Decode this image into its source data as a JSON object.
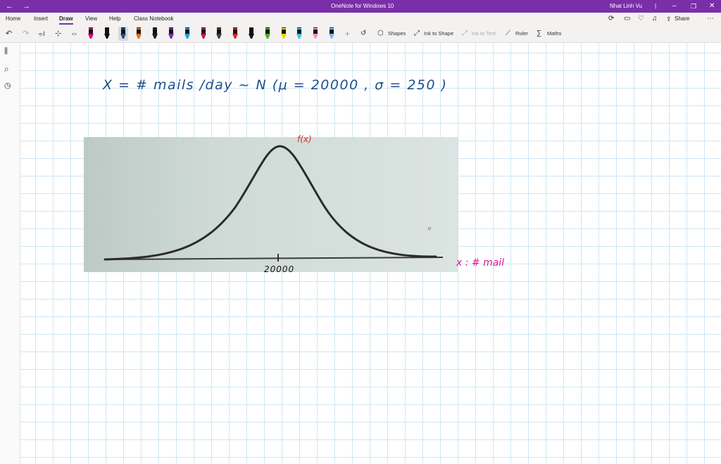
{
  "titlebar": {
    "app_title": "OneNote for Windows 10",
    "user_name": "Nhat Linh Vu",
    "separator": "|"
  },
  "ribbon": {
    "tabs": [
      {
        "label": "Home"
      },
      {
        "label": "Insert"
      },
      {
        "label": "Draw",
        "active": true
      },
      {
        "label": "View"
      },
      {
        "label": "Help"
      },
      {
        "label": "Class Notebook"
      }
    ],
    "share_label": "Share"
  },
  "toolbar": {
    "shapes_label": "Shapes",
    "ink_to_shape_label": "Ink to Shape",
    "ink_to_text_label": "Ink to Text",
    "ruler_label": "Ruler",
    "maths_label": "Maths",
    "pen_colors": [
      "#d6007a",
      "#111111",
      "#1f4e8c",
      "#e56b1f",
      "#222222",
      "#7a2fa8",
      "#1aa1e6",
      "#c2185b",
      "#444444",
      "#d62828",
      "#111111",
      "#4caf1a",
      "#f2d600",
      "#35c6e6",
      "#ff8ec7",
      "#7fb8ff"
    ]
  },
  "note": {
    "equation": "X = # mails /day ~ N (μ = 20000 , σ = 250 )",
    "fx_label": "f(x)",
    "x_axis_label": "x : # mail",
    "tick_label": "20000"
  },
  "colors": {
    "accent": "#7a2fa8",
    "ink_blue": "#1f4e8c",
    "ink_red": "#d62828",
    "ink_pink": "#e0199a"
  }
}
